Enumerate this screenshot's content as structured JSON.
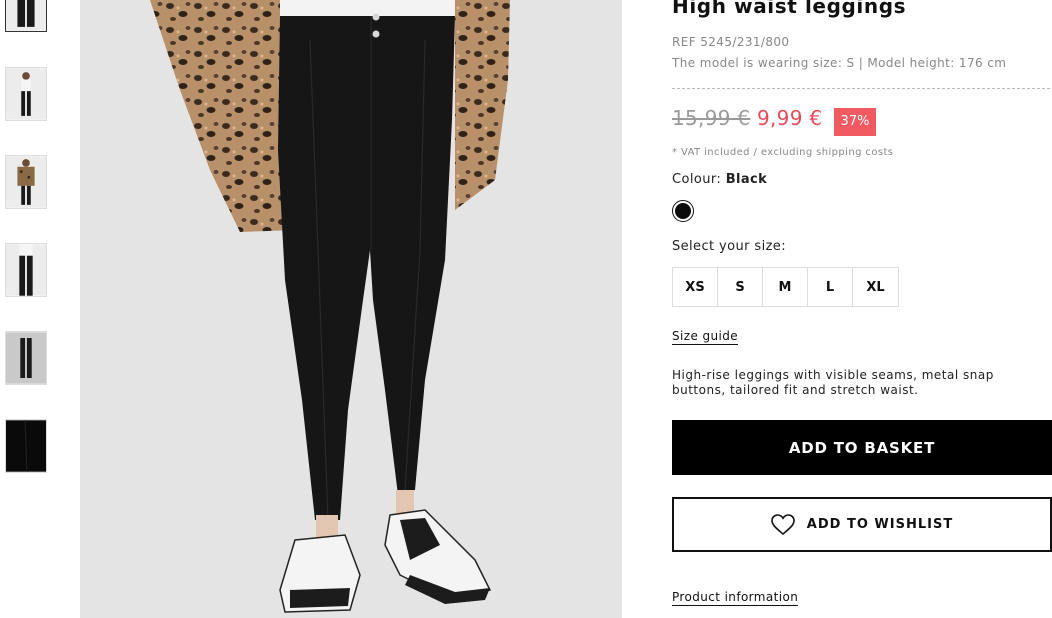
{
  "thumbnails": [
    {
      "name": "thumb-1",
      "active": true
    },
    {
      "name": "thumb-2",
      "active": false
    },
    {
      "name": "thumb-3",
      "active": false
    },
    {
      "name": "thumb-4",
      "active": false
    },
    {
      "name": "thumb-5",
      "active": false
    },
    {
      "name": "thumb-6",
      "active": false
    }
  ],
  "product": {
    "title": "High waist leggings",
    "ref": "REF 5245/231/800",
    "model_info": "The model is wearing size: S | Model height: 176 cm",
    "old_price": "15,99 €",
    "new_price": "9,99 €",
    "discount": "37%",
    "vat_note": "* VAT included / excluding shipping costs",
    "colour_label": "Colour:",
    "colour_value": "Black",
    "colour_hex": "#0c0c0c",
    "size_label": "Select your size:",
    "sizes": [
      "XS",
      "S",
      "M",
      "L",
      "XL"
    ],
    "size_guide": "Size guide",
    "description": "High-rise leggings with visible seams, metal snap buttons, tailored fit and stretch waist.",
    "add_to_basket": "ADD TO BASKET",
    "add_to_wishlist": "ADD TO WISHLIST",
    "wishlist_icon": "heart-icon",
    "product_information": "Product information"
  },
  "colors": {
    "sale_red": "#e84a5a",
    "badge_red": "#f25a62",
    "primary_black": "#000000"
  }
}
